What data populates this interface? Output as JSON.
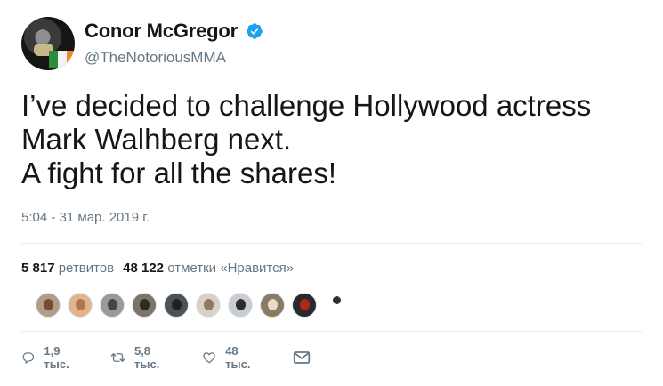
{
  "author": {
    "name": "Conor McGregor",
    "handle": "@TheNotoriousMMA",
    "verified": true
  },
  "tweet": {
    "lines": [
      "I’ve decided to challenge Hollywood actress",
      "Mark Walhberg next.",
      "A fight for all the shares!"
    ],
    "timestamp": "5:04 - 31 мар. 2019 г."
  },
  "stats": {
    "retweets_count": "5 817",
    "retweets_label": "ретвитов",
    "likes_count": "48 122",
    "likes_label": "отметки «Нравится»"
  },
  "likers": [
    {
      "icon": "avatar"
    },
    {
      "icon": "avatar"
    },
    {
      "icon": "avatar"
    },
    {
      "icon": "avatar"
    },
    {
      "icon": "avatar"
    },
    {
      "icon": "avatar"
    },
    {
      "icon": "avatar"
    },
    {
      "icon": "avatar"
    },
    {
      "icon": "avatar"
    },
    {
      "icon": "avatar"
    }
  ],
  "actions": {
    "reply_count": "1,9 тыс.",
    "retweet_count": "5,8 тыс.",
    "like_count": "48 тыс."
  },
  "colors": {
    "verified": "#1da1f2",
    "secondary_text": "#657786",
    "primary_text": "#14171a",
    "divider": "#e6ecf0"
  }
}
